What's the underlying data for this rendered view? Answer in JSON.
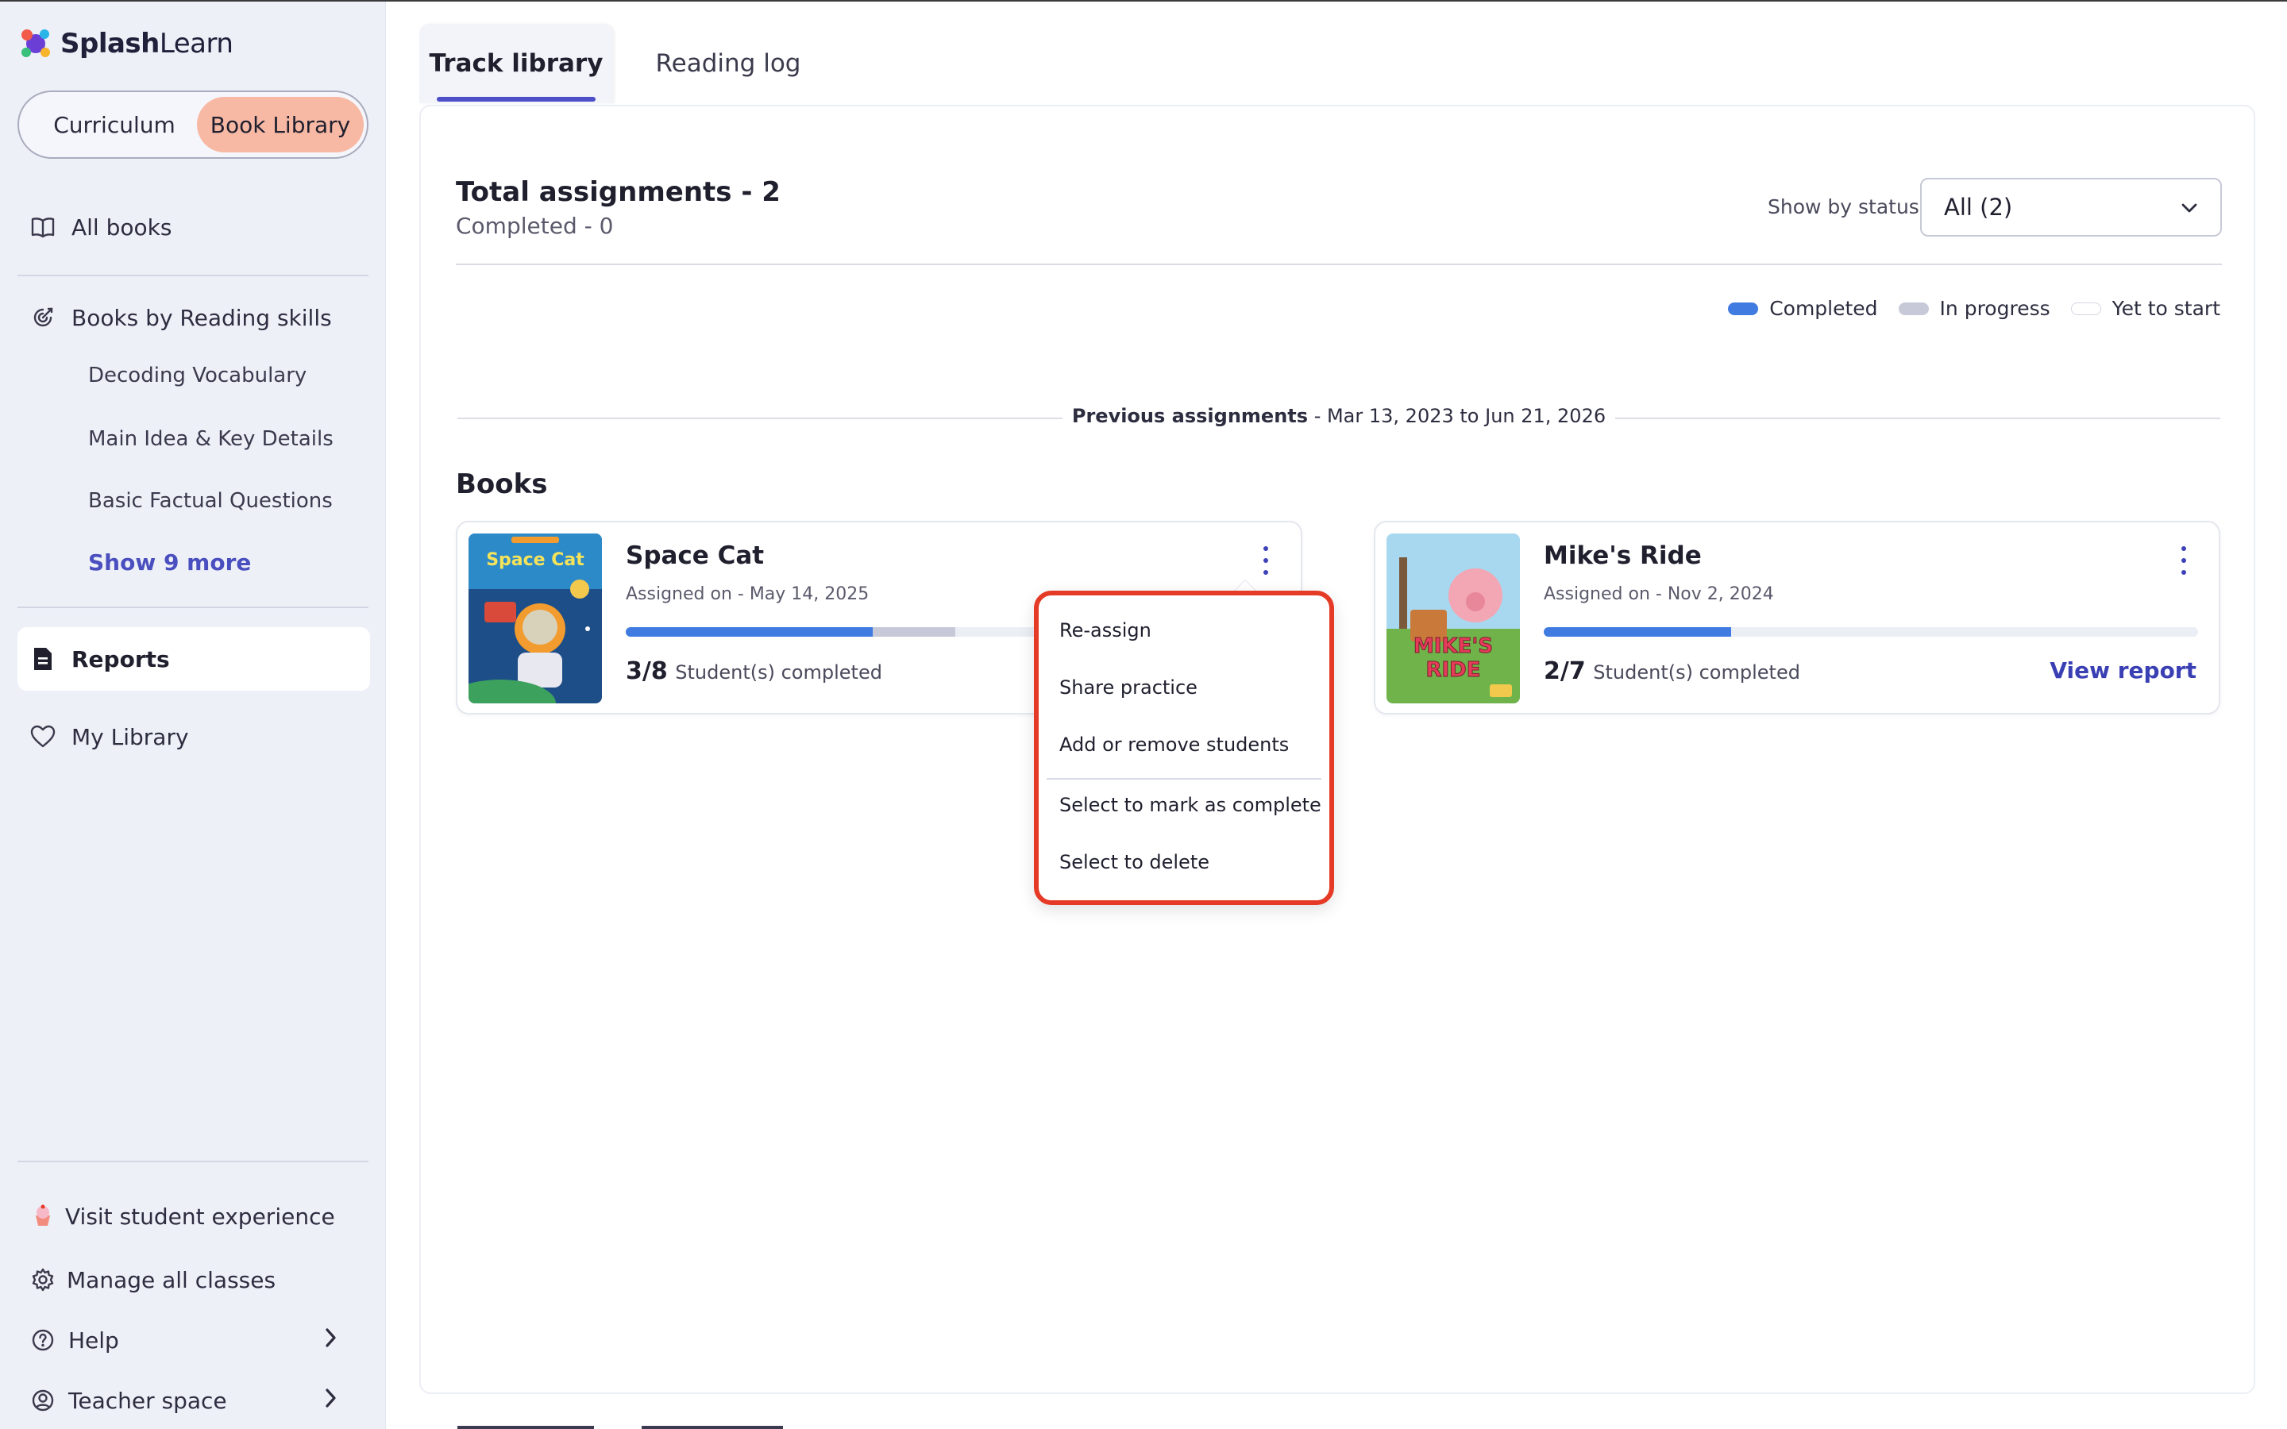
{
  "app": {
    "logo_text_bold": "Splash",
    "logo_text_light": "Learn"
  },
  "sidebar": {
    "switch": {
      "left": "Curriculum",
      "right": "Book Library"
    },
    "all_books": "All books",
    "reading_skills": "Books by Reading skills",
    "skills": [
      "Decoding Vocabulary",
      "Main Idea & Key Details",
      "Basic Factual Questions"
    ],
    "show_more": "Show 9 more",
    "reports": "Reports",
    "my_library": "My Library",
    "visit_student": "Visit student experience",
    "manage_classes": "Manage all classes",
    "help": "Help",
    "teacher_space": "Teacher space"
  },
  "tabs": {
    "active": "Track library",
    "inactive": "Reading log"
  },
  "summary": {
    "total": "Total assignments - 2",
    "completed": "Completed - 0",
    "status_label": "Show by status",
    "status_value": "All (2)"
  },
  "legend": [
    {
      "label": "Completed",
      "color": "#3f7be0"
    },
    {
      "label": "In progress",
      "color": "#c7c9d8"
    },
    {
      "label": "Yet to start",
      "color": "#ffffff"
    }
  ],
  "previous": {
    "label": "Previous assignments",
    "range": "- Mar 13, 2023 to Jun 21, 2026"
  },
  "books_heading": "Books",
  "books": [
    {
      "title": "Space Cat",
      "assigned": "Assigned on - May 14, 2025",
      "count": "3/8",
      "count_suffix": "Student(s) completed",
      "completed_fraction": 0.375,
      "in_progress_fraction": 0.125
    },
    {
      "title": "Mike's Ride",
      "assigned": "Assigned on - Nov 2, 2024",
      "count": "2/7",
      "count_suffix": "Student(s) completed",
      "completed_fraction": 0.286,
      "in_progress_fraction": 0,
      "view_report": "View report"
    }
  ],
  "menu": [
    "Re-assign",
    "Share practice",
    "Add or remove students",
    "Select to mark as complete",
    "Select to delete"
  ]
}
